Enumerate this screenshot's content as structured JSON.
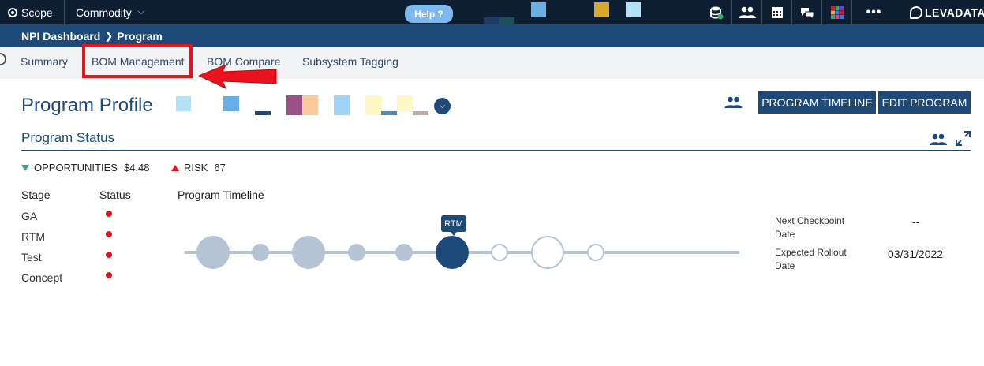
{
  "topbar": {
    "scope_label": "Scope",
    "commodity_label": "Commodity",
    "help_label": "Help ?",
    "logo_text": "LEVADATA"
  },
  "breadcrumb": {
    "items": [
      "NPI Dashboard",
      "Program"
    ]
  },
  "tabs": [
    {
      "label": "Summary"
    },
    {
      "label": "BOM Management"
    },
    {
      "label": "BOM Compare"
    },
    {
      "label": "Subsystem Tagging"
    }
  ],
  "profile": {
    "title": "Program Profile",
    "timeline_button": "PROGRAM TIMELINE",
    "edit_button": "EDIT PROGRAM"
  },
  "status": {
    "title": "Program Status",
    "opportunities_label": "OPPORTUNITIES",
    "opportunities_value": "$4.48",
    "risk_label": "RISK",
    "risk_value": "67",
    "stage_header": "Stage",
    "status_header": "Status",
    "stages": [
      {
        "name": "GA",
        "status_color": "#e8131d"
      },
      {
        "name": "RTM",
        "status_color": "#e8131d"
      },
      {
        "name": "Test",
        "status_color": "#e8131d"
      },
      {
        "name": "Concept",
        "status_color": "#e8131d"
      }
    ],
    "timeline_title": "Program Timeline",
    "current_milestone": "RTM",
    "next_checkpoint_label": "Next Checkpoint Date",
    "next_checkpoint_value": "--",
    "expected_rollout_label": "Expected Rollout Date",
    "expected_rollout_value": "03/31/2022"
  },
  "colors": {
    "primary": "#1e4a7a",
    "topbar": "#0e1e33",
    "alert_red": "#e8131d",
    "positive_green": "#3aa76d",
    "timeline_past": "#b5c3d4",
    "timeline_future": "#ffffff"
  }
}
